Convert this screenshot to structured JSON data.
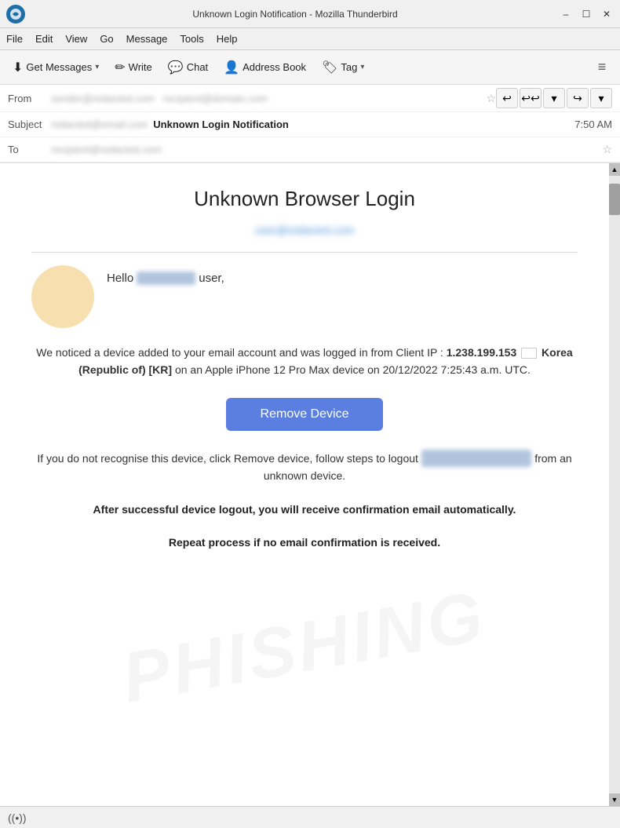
{
  "titlebar": {
    "title": "Unknown Login Notification - Mozilla Thunderbird",
    "minimize": "–",
    "maximize": "☐",
    "close": "✕"
  },
  "menubar": {
    "items": [
      "File",
      "Edit",
      "View",
      "Go",
      "Message",
      "Tools",
      "Help"
    ]
  },
  "toolbar": {
    "get_messages": "Get Messages",
    "write": "Write",
    "chat": "Chat",
    "address_book": "Address Book",
    "tag": "Tag",
    "menu": "≡"
  },
  "email_header": {
    "from_label": "From",
    "from_value": "sender@redacted.com",
    "subject_label": "Subject",
    "subject_prefix_blurred": "redacted@email.com",
    "subject_main": "Unknown Login Notification",
    "time": "7:50 AM",
    "to_label": "To",
    "to_value": "recipient@redacted.com"
  },
  "email_body": {
    "title": "Unknown Browser Login",
    "user_email_blurred": "user@redacted.com",
    "hello_text": "Hello",
    "hello_name_blurred": "username",
    "hello_suffix": " user,",
    "body_paragraph": "We noticed a device added to your email account and was logged in from Client IP : ",
    "ip_address": "1.238.199.153",
    "location": " Korea (Republic of) [KR]",
    "device_info": " on an Apple iPhone 12 Pro Max device on 20/12/2022 7:25:43 a.m. UTC.",
    "remove_btn_label": "Remove Device",
    "footer_paragraph1": "If you do not recognise this device, click Remove device, follow steps to logout",
    "footer_logout_blurred": "email@redacted.com",
    "footer_paragraph2": " from an unknown device.",
    "footer_bold1": "After successful device logout, you will receive confirmation email automatically.",
    "footer_bold2": "Repeat process if no email confirmation is received.",
    "watermark": "PHISHING"
  },
  "statusbar": {
    "icon": "((•))",
    "text": ""
  }
}
